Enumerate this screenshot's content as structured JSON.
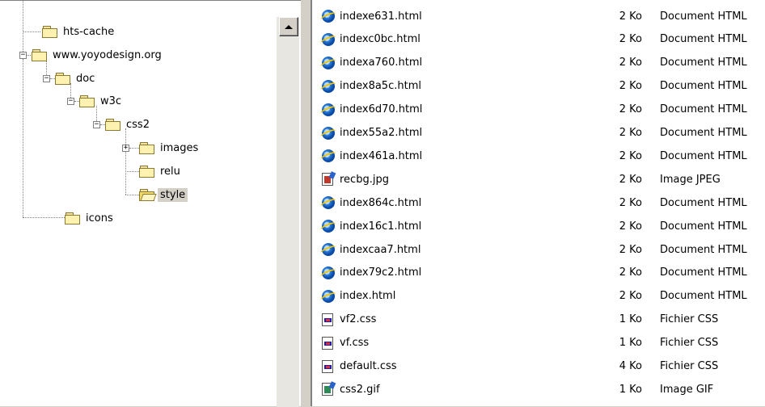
{
  "tree": {
    "items": [
      {
        "label": "hts-cache"
      },
      {
        "label": "www.yoyodesign.org"
      },
      {
        "label": "doc"
      },
      {
        "label": "w3c"
      },
      {
        "label": "css2"
      },
      {
        "label": "images"
      },
      {
        "label": "relu"
      },
      {
        "label": "style",
        "selected": true
      },
      {
        "label": "icons"
      }
    ],
    "expander_plus": "+",
    "expander_minus": "−"
  },
  "files": [
    {
      "name": "indexe631.html",
      "size": "2 Ko",
      "type": "Document HTML",
      "icon": "ie-html-icon"
    },
    {
      "name": "indexc0bc.html",
      "size": "2 Ko",
      "type": "Document HTML",
      "icon": "ie-html-icon"
    },
    {
      "name": "indexa760.html",
      "size": "2 Ko",
      "type": "Document HTML",
      "icon": "ie-html-icon"
    },
    {
      "name": "index8a5c.html",
      "size": "2 Ko",
      "type": "Document HTML",
      "icon": "ie-html-icon"
    },
    {
      "name": "index6d70.html",
      "size": "2 Ko",
      "type": "Document HTML",
      "icon": "ie-html-icon"
    },
    {
      "name": "index55a2.html",
      "size": "2 Ko",
      "type": "Document HTML",
      "icon": "ie-html-icon"
    },
    {
      "name": "index461a.html",
      "size": "2 Ko",
      "type": "Document HTML",
      "icon": "ie-html-icon"
    },
    {
      "name": "recbg.jpg",
      "size": "2 Ko",
      "type": "Image JPEG",
      "icon": "jpeg-image-icon"
    },
    {
      "name": "index864c.html",
      "size": "2 Ko",
      "type": "Document HTML",
      "icon": "ie-html-icon"
    },
    {
      "name": "index16c1.html",
      "size": "2 Ko",
      "type": "Document HTML",
      "icon": "ie-html-icon"
    },
    {
      "name": "indexcaa7.html",
      "size": "2 Ko",
      "type": "Document HTML",
      "icon": "ie-html-icon"
    },
    {
      "name": "index79c2.html",
      "size": "2 Ko",
      "type": "Document HTML",
      "icon": "ie-html-icon"
    },
    {
      "name": "index.html",
      "size": "2 Ko",
      "type": "Document HTML",
      "icon": "ie-html-icon"
    },
    {
      "name": "vf2.css",
      "size": "1 Ko",
      "type": "Fichier CSS",
      "icon": "css-file-icon"
    },
    {
      "name": "vf.css",
      "size": "1 Ko",
      "type": "Fichier CSS",
      "icon": "css-file-icon"
    },
    {
      "name": "default.css",
      "size": "4 Ko",
      "type": "Fichier CSS",
      "icon": "css-file-icon"
    },
    {
      "name": "css2.gif",
      "size": "1 Ko",
      "type": "Image GIF",
      "icon": "gif-image-icon"
    }
  ]
}
